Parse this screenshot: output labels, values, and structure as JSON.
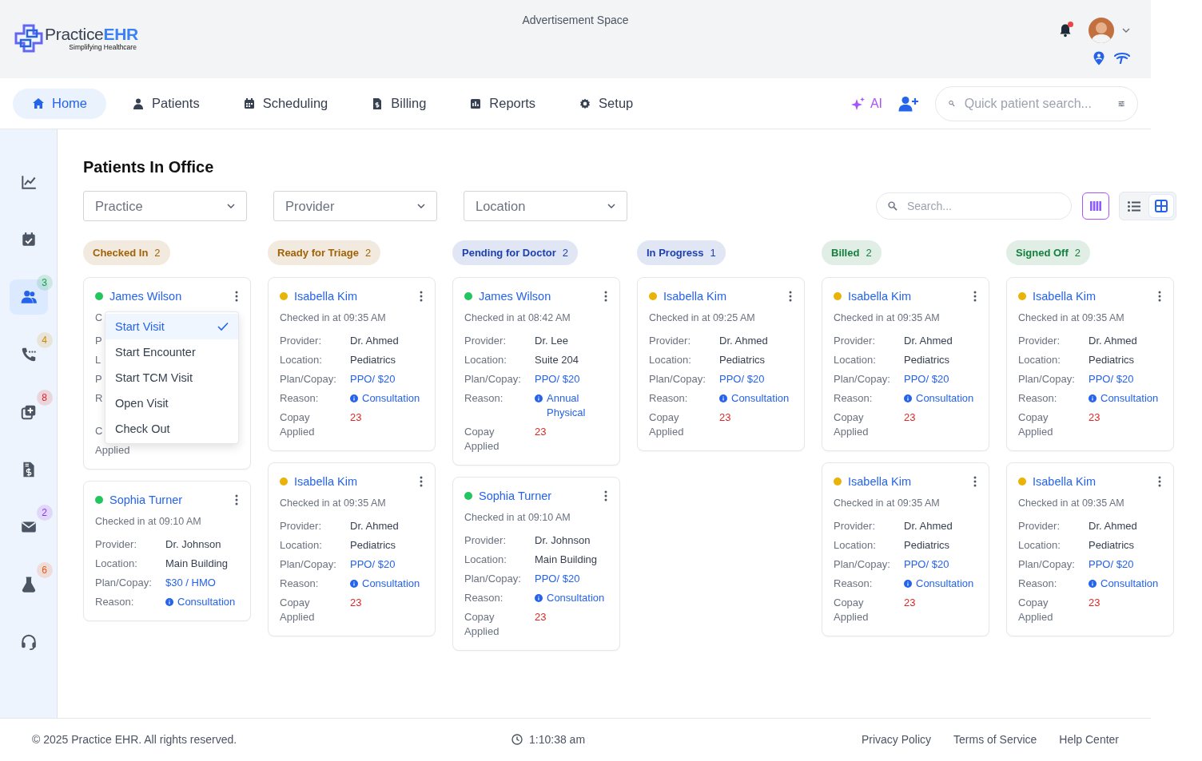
{
  "header": {
    "logo": {
      "name_a": "Practice",
      "name_b": "EHR",
      "tagline": "Simplifying Healthcare"
    },
    "ad": "Advertisement Space",
    "notifications": {
      "unread": true
    }
  },
  "nav": {
    "items": [
      {
        "label": "Home",
        "selected": true
      },
      {
        "label": "Patients",
        "selected": false
      },
      {
        "label": "Scheduling",
        "selected": false
      },
      {
        "label": "Billing",
        "selected": false
      },
      {
        "label": "Reports",
        "selected": false
      },
      {
        "label": "Setup",
        "selected": false
      }
    ],
    "ai": "AI",
    "search": {
      "placeholder": "Quick patient search..."
    }
  },
  "sidebar": {
    "items": [
      {
        "selected": false
      },
      {
        "selected": false
      },
      {
        "selected": true,
        "badge": "3",
        "color": "#16a34a"
      },
      {
        "selected": false,
        "badge": "4",
        "color": "#ca8a04"
      },
      {
        "selected": false,
        "badge": "8",
        "color": "#dc2626"
      },
      {
        "selected": false
      },
      {
        "selected": false,
        "badge": "2",
        "color": "#9333ea"
      },
      {
        "selected": false,
        "badge": "6",
        "color": "#ea580c"
      },
      {
        "selected": false
      }
    ]
  },
  "page": {
    "title": "Patients In Office",
    "filters": [
      {
        "placeholder": "Practice"
      },
      {
        "placeholder": "Provider"
      },
      {
        "placeholder": "Location"
      }
    ],
    "search": {
      "placeholder": "Search..."
    },
    "views": [
      {
        "selected": true
      },
      {
        "selected": false
      },
      {
        "selected": true
      }
    ]
  },
  "columns": [
    {
      "label": "Checked In",
      "count": "2",
      "color": "#a16207",
      "cards": [
        {
          "name": "James Wilson",
          "color": "#22c55e",
          "checked_in": "C",
          "fields": [
            {
              "label": "P",
              "kind": "covered"
            },
            {
              "label": "L",
              "kind": "covered"
            },
            {
              "label": "P",
              "kind": "covered"
            },
            {
              "label": "R",
              "kind": "covered"
            },
            {
              "label": "C",
              "kind": "covered-gap"
            },
            {
              "label": "Applied",
              "kind": "covered"
            }
          ],
          "menu": [
            {
              "label": "Start Visit",
              "selected": true
            },
            {
              "label": "Start Encounter",
              "selected": false
            },
            {
              "label": "Start TCM Visit",
              "selected": false
            },
            {
              "label": "Open Visit",
              "selected": false
            },
            {
              "label": "Check Out",
              "selected": false
            }
          ]
        },
        {
          "name": "Sophia Turner",
          "color": "#22c55e",
          "checked_in": "Checked in at 09:10 AM",
          "fields": [
            {
              "label": "Provider:",
              "value": "Dr. Johnson",
              "kind": "text"
            },
            {
              "label": "Location:",
              "value": "Main Building",
              "kind": "text"
            },
            {
              "label": "Plan/Copay:",
              "value": "$30 / HMO",
              "kind": "link"
            },
            {
              "label": "Reason:",
              "value": "Consultation",
              "kind": "reason"
            }
          ]
        }
      ]
    },
    {
      "label": "Ready for Triage",
      "count": "2",
      "color": "#a16207",
      "cards": [
        {
          "name": "Isabella Kim",
          "color": "#eab308",
          "checked_in": "Checked in at 09:35 AM",
          "fields": [
            {
              "label": "Provider:",
              "value": "Dr. Ahmed",
              "kind": "text"
            },
            {
              "label": "Location:",
              "value": "Pediatrics",
              "kind": "text"
            },
            {
              "label": "Plan/Copay:",
              "value": "PPO/ $20",
              "kind": "link"
            },
            {
              "label": "Reason:",
              "value": "Consultation",
              "kind": "reason"
            },
            {
              "label": "Copay Applied",
              "value": "23",
              "kind": "alert"
            }
          ]
        },
        {
          "name": "Isabella Kim",
          "color": "#eab308",
          "checked_in": "Checked in at 09:35 AM",
          "fields": [
            {
              "label": "Provider:",
              "value": "Dr. Ahmed",
              "kind": "text"
            },
            {
              "label": "Location:",
              "value": "Pediatrics",
              "kind": "text"
            },
            {
              "label": "Plan/Copay:",
              "value": "PPO/ $20",
              "kind": "link"
            },
            {
              "label": "Reason:",
              "value": "Consultation",
              "kind": "reason"
            },
            {
              "label": "Copay Applied",
              "value": "23",
              "kind": "alert"
            }
          ]
        }
      ]
    },
    {
      "label": "Pending for Doctor",
      "count": "2",
      "color": "#1e40af",
      "cards": [
        {
          "name": "James Wilson",
          "color": "#22c55e",
          "checked_in": "Checked in at 08:42 AM",
          "fields": [
            {
              "label": "Provider:",
              "value": "Dr. Lee",
              "kind": "text"
            },
            {
              "label": "Location:",
              "value": "Suite 204",
              "kind": "text"
            },
            {
              "label": "Plan/Copay:",
              "value": "PPO/ $20",
              "kind": "link"
            },
            {
              "label": "Reason:",
              "value": "Annual Physical",
              "kind": "reason"
            },
            {
              "label": "Copay Applied",
              "value": "23",
              "kind": "alert"
            }
          ]
        },
        {
          "name": "Sophia Turner",
          "color": "#22c55e",
          "checked_in": "Checked in at 09:10 AM",
          "fields": [
            {
              "label": "Provider:",
              "value": "Dr. Johnson",
              "kind": "text"
            },
            {
              "label": "Location:",
              "value": "Main Building",
              "kind": "text"
            },
            {
              "label": "Plan/Copay:",
              "value": "PPO/ $20",
              "kind": "link"
            },
            {
              "label": "Reason:",
              "value": "Consultation",
              "kind": "reason"
            },
            {
              "label": "Copay Applied",
              "value": "23",
              "kind": "alert"
            }
          ]
        }
      ]
    },
    {
      "label": "In Progress",
      "count": "1",
      "color": "#1e40af",
      "cards": [
        {
          "name": "Isabella Kim",
          "color": "#eab308",
          "checked_in": "Checked in at 09:25 AM",
          "fields": [
            {
              "label": "Provider:",
              "value": "Dr. Ahmed",
              "kind": "text"
            },
            {
              "label": "Location:",
              "value": "Pediatrics",
              "kind": "text"
            },
            {
              "label": "Plan/Copay:",
              "value": "PPO/ $20",
              "kind": "link"
            },
            {
              "label": "Reason:",
              "value": "Consultation",
              "kind": "reason"
            },
            {
              "label": "Copay Applied",
              "value": "23",
              "kind": "alert"
            }
          ]
        }
      ]
    },
    {
      "label": "Billed",
      "count": "2",
      "color": "#15803d",
      "cards": [
        {
          "name": "Isabella Kim",
          "color": "#eab308",
          "checked_in": "Checked in at 09:35 AM",
          "fields": [
            {
              "label": "Provider:",
              "value": "Dr. Ahmed",
              "kind": "text"
            },
            {
              "label": "Location:",
              "value": "Pediatrics",
              "kind": "text"
            },
            {
              "label": "Plan/Copay:",
              "value": "PPO/ $20",
              "kind": "link"
            },
            {
              "label": "Reason:",
              "value": "Consultation",
              "kind": "reason"
            },
            {
              "label": "Copay Applied",
              "value": "23",
              "kind": "alert"
            }
          ]
        },
        {
          "name": "Isabella Kim",
          "color": "#eab308",
          "checked_in": "Checked in at 09:35 AM",
          "fields": [
            {
              "label": "Provider:",
              "value": "Dr. Ahmed",
              "kind": "text"
            },
            {
              "label": "Location:",
              "value": "Pediatrics",
              "kind": "text"
            },
            {
              "label": "Plan/Copay:",
              "value": "PPO/ $20",
              "kind": "link"
            },
            {
              "label": "Reason:",
              "value": "Consultation",
              "kind": "reason"
            },
            {
              "label": "Copay Applied",
              "value": "23",
              "kind": "alert"
            }
          ]
        }
      ]
    },
    {
      "label": "Signed Off",
      "count": "2",
      "color": "#15803d",
      "cards": [
        {
          "name": "Isabella Kim",
          "color": "#eab308",
          "checked_in": "Checked in at 09:35 AM",
          "fields": [
            {
              "label": "Provider:",
              "value": "Dr. Ahmed",
              "kind": "text"
            },
            {
              "label": "Location:",
              "value": "Pediatrics",
              "kind": "text"
            },
            {
              "label": "Plan/Copay:",
              "value": "PPO/ $20",
              "kind": "link"
            },
            {
              "label": "Reason:",
              "value": "Consultation",
              "kind": "reason"
            },
            {
              "label": "Copay Applied",
              "value": "23",
              "kind": "alert"
            }
          ]
        },
        {
          "name": "Isabella Kim",
          "color": "#eab308",
          "checked_in": "Checked in at 09:35 AM",
          "fields": [
            {
              "label": "Provider:",
              "value": "Dr. Ahmed",
              "kind": "text"
            },
            {
              "label": "Location:",
              "value": "Pediatrics",
              "kind": "text"
            },
            {
              "label": "Plan/Copay:",
              "value": "PPO/ $20",
              "kind": "link"
            },
            {
              "label": "Reason:",
              "value": "Consultation",
              "kind": "reason"
            },
            {
              "label": "Copay Applied",
              "value": "23",
              "kind": "alert"
            }
          ]
        }
      ]
    }
  ],
  "footer": {
    "copyright": "© 2025 Practice EHR. All rights reserved.",
    "time": "1:10:38 am",
    "links": [
      "Privacy Policy",
      "Terms of Service",
      "Help Center"
    ]
  }
}
